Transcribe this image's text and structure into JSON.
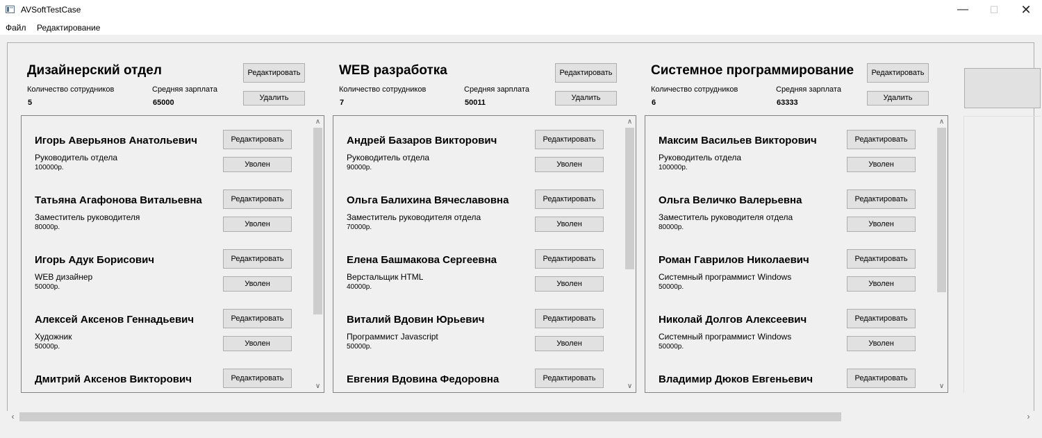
{
  "window": {
    "title": "AVSoftTestCase",
    "minimize_glyph": "—",
    "maximize_glyph": "☐",
    "close_glyph": "✕"
  },
  "menu": [
    "Файл",
    "Редактирование"
  ],
  "labels": {
    "employee_count": "Количество сотрудников",
    "avg_salary": "Средняя зарплата",
    "edit": "Редактировать",
    "delete": "Удалить",
    "fire": "Уволен"
  },
  "departments": [
    {
      "name": "Дизайнерский отдел",
      "employee_count": "5",
      "avg_salary": "65000",
      "employees": [
        {
          "name": "Игорь Аверьянов Анатольевич",
          "position": "Руководитель отдела",
          "salary": "100000р."
        },
        {
          "name": "Татьяна Агафонова Витальевна",
          "position": "Заместитель руководителя",
          "salary": "80000р."
        },
        {
          "name": "Игорь Адук Борисович",
          "position": "WEB дизайнер",
          "salary": "50000р."
        },
        {
          "name": "Алексей Аксенов Геннадьевич",
          "position": "Художник",
          "salary": "50000р."
        },
        {
          "name": "Дмитрий Аксенов Викторович",
          "position": "",
          "salary": ""
        }
      ]
    },
    {
      "name": "WEB разработка",
      "employee_count": "7",
      "avg_salary": "50011",
      "employees": [
        {
          "name": "Андрей Базаров Викторович",
          "position": "Руководитель отдела",
          "salary": "90000р."
        },
        {
          "name": "Ольга Балихина Вячеславовна",
          "position": "Заместитель руководителя отдела",
          "salary": "70000р."
        },
        {
          "name": "Елена Башмакова Сергеевна",
          "position": "Верстальщик HTML",
          "salary": "40000р."
        },
        {
          "name": "Виталий Вдовин Юрьевич",
          "position": "Программист Javascript",
          "salary": "50000р."
        },
        {
          "name": "Евгения Вдовина Федоровна",
          "position": "",
          "salary": ""
        }
      ]
    },
    {
      "name": "Системное программирование",
      "employee_count": "6",
      "avg_salary": "63333",
      "employees": [
        {
          "name": "Максим Васильев Викторович",
          "position": "Руководитель отдела",
          "salary": "100000р."
        },
        {
          "name": "Ольга Величко Валерьевна",
          "position": "Заместитель руководителя отдела",
          "salary": "80000р."
        },
        {
          "name": "Роман Гаврилов Николаевич",
          "position": "Системный программист Windows",
          "salary": "50000р."
        },
        {
          "name": "Николай Долгов Алексеевич",
          "position": "Системный программист Windows",
          "salary": "50000р."
        },
        {
          "name": "Владимир Дюков Евгеньевич",
          "position": "",
          "salary": ""
        }
      ]
    }
  ],
  "list_scroll_thumbs": [
    {
      "start": 0.0,
      "size": 0.74
    },
    {
      "start": 0.0,
      "size": 0.56
    },
    {
      "start": 0.0,
      "size": 0.65
    }
  ],
  "horizontal_scroll_thumb": {
    "start": 0.0,
    "size": 0.82
  }
}
